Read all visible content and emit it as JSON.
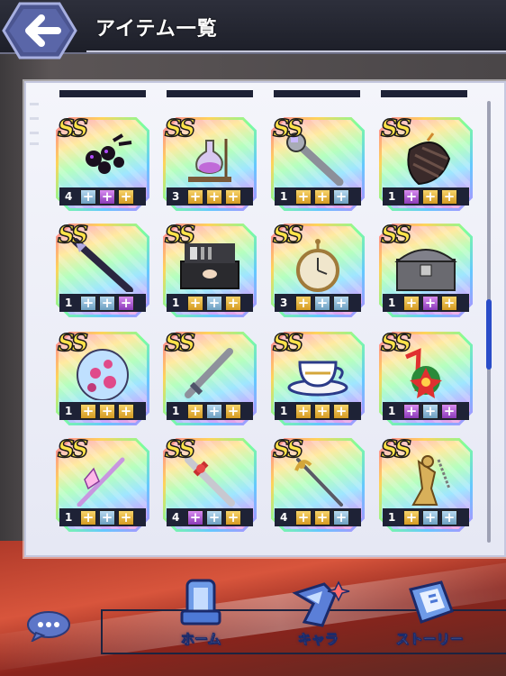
{
  "header": {
    "title": "アイテム一覧",
    "back_icon": "arrow-left-icon"
  },
  "nav": {
    "home_label": "ホーム",
    "chara_label": "キャラ",
    "story_label": "ストーリー"
  },
  "items": [
    {
      "rank": "SS",
      "count": "4",
      "slots": [
        "b",
        "p",
        "g"
      ],
      "icon": "dark-flowers-icon"
    },
    {
      "rank": "SS",
      "count": "3",
      "slots": [
        "g",
        "g",
        "g"
      ],
      "icon": "alchemy-flask-icon"
    },
    {
      "rank": "SS",
      "count": "1",
      "slots": [
        "g",
        "g",
        "b"
      ],
      "icon": "wrench-icon"
    },
    {
      "rank": "SS",
      "count": "1",
      "slots": [
        "p",
        "g",
        "g"
      ],
      "icon": "gauntlet-icon"
    },
    {
      "rank": "SS",
      "count": "1",
      "slots": [
        "b",
        "b",
        "p"
      ],
      "icon": "spear-icon"
    },
    {
      "rank": "SS",
      "count": "1",
      "slots": [
        "g",
        "b",
        "g"
      ],
      "icon": "makeup-case-icon"
    },
    {
      "rank": "SS",
      "count": "3",
      "slots": [
        "g",
        "b",
        "b"
      ],
      "icon": "pocket-watch-icon"
    },
    {
      "rank": "SS",
      "count": "1",
      "slots": [
        "g",
        "p",
        "g"
      ],
      "icon": "treasure-chest-icon"
    },
    {
      "rank": "SS",
      "count": "1",
      "slots": [
        "g",
        "g",
        "g"
      ],
      "icon": "sakura-orb-icon"
    },
    {
      "rank": "SS",
      "count": "1",
      "slots": [
        "g",
        "b",
        "g"
      ],
      "icon": "sword-icon"
    },
    {
      "rank": "SS",
      "count": "1",
      "slots": [
        "g",
        "g",
        "g"
      ],
      "icon": "teacup-icon"
    },
    {
      "rank": "SS",
      "count": "1",
      "slots": [
        "p",
        "b",
        "p"
      ],
      "icon": "christmas-ribbon-icon"
    },
    {
      "rank": "SS",
      "count": "1",
      "slots": [
        "g",
        "b",
        "g"
      ],
      "icon": "crystal-wand-icon"
    },
    {
      "rank": "SS",
      "count": "4",
      "slots": [
        "p",
        "b",
        "g"
      ],
      "icon": "ornate-sword-icon"
    },
    {
      "rank": "SS",
      "count": "4",
      "slots": [
        "g",
        "g",
        "b"
      ],
      "icon": "rapier-icon"
    },
    {
      "rank": "SS",
      "count": "1",
      "slots": [
        "g",
        "b",
        "b"
      ],
      "icon": "golden-statue-icon"
    }
  ]
}
